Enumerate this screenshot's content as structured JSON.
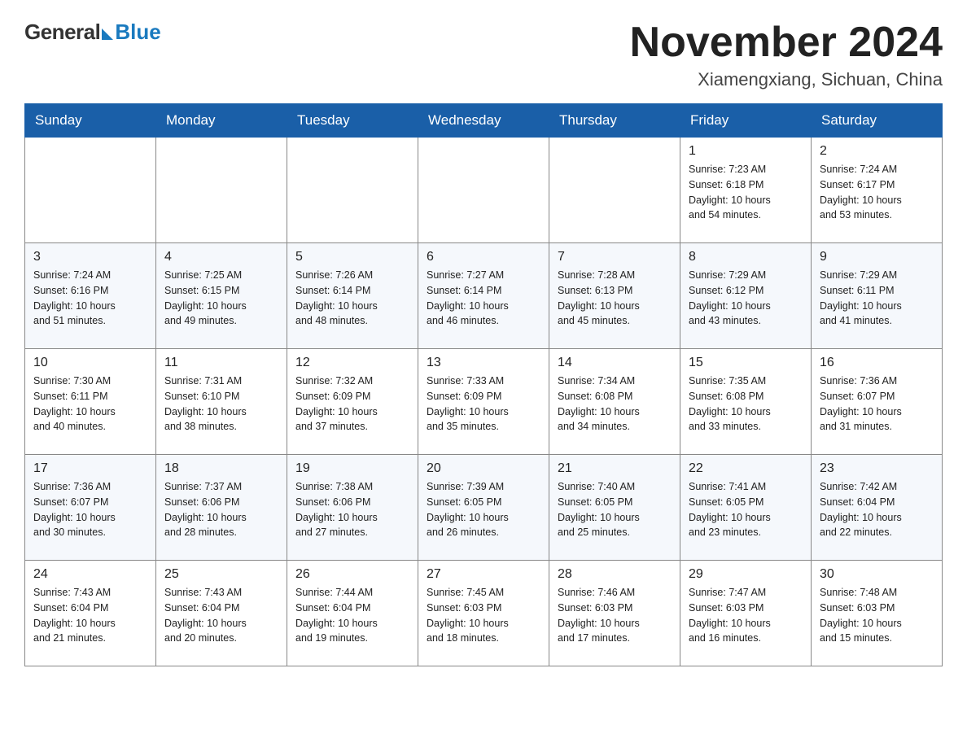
{
  "header": {
    "title": "November 2024",
    "subtitle": "Xiamengxiang, Sichuan, China"
  },
  "logo": {
    "general": "General",
    "blue": "Blue"
  },
  "days_of_week": [
    "Sunday",
    "Monday",
    "Tuesday",
    "Wednesday",
    "Thursday",
    "Friday",
    "Saturday"
  ],
  "weeks": [
    [
      {
        "day": "",
        "info": ""
      },
      {
        "day": "",
        "info": ""
      },
      {
        "day": "",
        "info": ""
      },
      {
        "day": "",
        "info": ""
      },
      {
        "day": "",
        "info": ""
      },
      {
        "day": "1",
        "info": "Sunrise: 7:23 AM\nSunset: 6:18 PM\nDaylight: 10 hours\nand 54 minutes."
      },
      {
        "day": "2",
        "info": "Sunrise: 7:24 AM\nSunset: 6:17 PM\nDaylight: 10 hours\nand 53 minutes."
      }
    ],
    [
      {
        "day": "3",
        "info": "Sunrise: 7:24 AM\nSunset: 6:16 PM\nDaylight: 10 hours\nand 51 minutes."
      },
      {
        "day": "4",
        "info": "Sunrise: 7:25 AM\nSunset: 6:15 PM\nDaylight: 10 hours\nand 49 minutes."
      },
      {
        "day": "5",
        "info": "Sunrise: 7:26 AM\nSunset: 6:14 PM\nDaylight: 10 hours\nand 48 minutes."
      },
      {
        "day": "6",
        "info": "Sunrise: 7:27 AM\nSunset: 6:14 PM\nDaylight: 10 hours\nand 46 minutes."
      },
      {
        "day": "7",
        "info": "Sunrise: 7:28 AM\nSunset: 6:13 PM\nDaylight: 10 hours\nand 45 minutes."
      },
      {
        "day": "8",
        "info": "Sunrise: 7:29 AM\nSunset: 6:12 PM\nDaylight: 10 hours\nand 43 minutes."
      },
      {
        "day": "9",
        "info": "Sunrise: 7:29 AM\nSunset: 6:11 PM\nDaylight: 10 hours\nand 41 minutes."
      }
    ],
    [
      {
        "day": "10",
        "info": "Sunrise: 7:30 AM\nSunset: 6:11 PM\nDaylight: 10 hours\nand 40 minutes."
      },
      {
        "day": "11",
        "info": "Sunrise: 7:31 AM\nSunset: 6:10 PM\nDaylight: 10 hours\nand 38 minutes."
      },
      {
        "day": "12",
        "info": "Sunrise: 7:32 AM\nSunset: 6:09 PM\nDaylight: 10 hours\nand 37 minutes."
      },
      {
        "day": "13",
        "info": "Sunrise: 7:33 AM\nSunset: 6:09 PM\nDaylight: 10 hours\nand 35 minutes."
      },
      {
        "day": "14",
        "info": "Sunrise: 7:34 AM\nSunset: 6:08 PM\nDaylight: 10 hours\nand 34 minutes."
      },
      {
        "day": "15",
        "info": "Sunrise: 7:35 AM\nSunset: 6:08 PM\nDaylight: 10 hours\nand 33 minutes."
      },
      {
        "day": "16",
        "info": "Sunrise: 7:36 AM\nSunset: 6:07 PM\nDaylight: 10 hours\nand 31 minutes."
      }
    ],
    [
      {
        "day": "17",
        "info": "Sunrise: 7:36 AM\nSunset: 6:07 PM\nDaylight: 10 hours\nand 30 minutes."
      },
      {
        "day": "18",
        "info": "Sunrise: 7:37 AM\nSunset: 6:06 PM\nDaylight: 10 hours\nand 28 minutes."
      },
      {
        "day": "19",
        "info": "Sunrise: 7:38 AM\nSunset: 6:06 PM\nDaylight: 10 hours\nand 27 minutes."
      },
      {
        "day": "20",
        "info": "Sunrise: 7:39 AM\nSunset: 6:05 PM\nDaylight: 10 hours\nand 26 minutes."
      },
      {
        "day": "21",
        "info": "Sunrise: 7:40 AM\nSunset: 6:05 PM\nDaylight: 10 hours\nand 25 minutes."
      },
      {
        "day": "22",
        "info": "Sunrise: 7:41 AM\nSunset: 6:05 PM\nDaylight: 10 hours\nand 23 minutes."
      },
      {
        "day": "23",
        "info": "Sunrise: 7:42 AM\nSunset: 6:04 PM\nDaylight: 10 hours\nand 22 minutes."
      }
    ],
    [
      {
        "day": "24",
        "info": "Sunrise: 7:43 AM\nSunset: 6:04 PM\nDaylight: 10 hours\nand 21 minutes."
      },
      {
        "day": "25",
        "info": "Sunrise: 7:43 AM\nSunset: 6:04 PM\nDaylight: 10 hours\nand 20 minutes."
      },
      {
        "day": "26",
        "info": "Sunrise: 7:44 AM\nSunset: 6:04 PM\nDaylight: 10 hours\nand 19 minutes."
      },
      {
        "day": "27",
        "info": "Sunrise: 7:45 AM\nSunset: 6:03 PM\nDaylight: 10 hours\nand 18 minutes."
      },
      {
        "day": "28",
        "info": "Sunrise: 7:46 AM\nSunset: 6:03 PM\nDaylight: 10 hours\nand 17 minutes."
      },
      {
        "day": "29",
        "info": "Sunrise: 7:47 AM\nSunset: 6:03 PM\nDaylight: 10 hours\nand 16 minutes."
      },
      {
        "day": "30",
        "info": "Sunrise: 7:48 AM\nSunset: 6:03 PM\nDaylight: 10 hours\nand 15 minutes."
      }
    ]
  ]
}
